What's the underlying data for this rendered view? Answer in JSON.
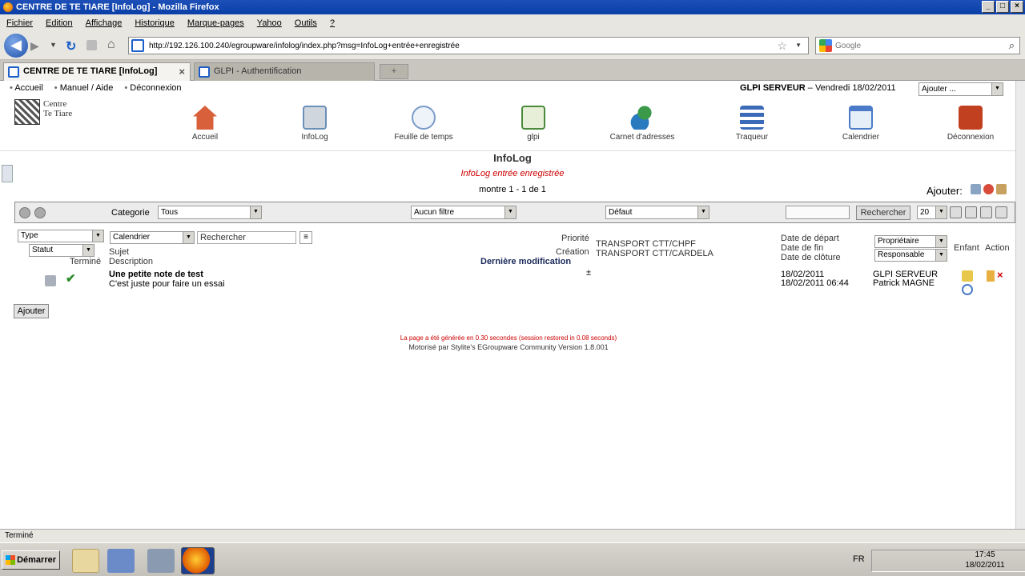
{
  "window": {
    "title": "CENTRE DE TE TIARE [InfoLog] - Mozilla Firefox",
    "buttons": [
      "_",
      "□",
      "×"
    ]
  },
  "menu": [
    "Fichier",
    "Edition",
    "Affichage",
    "Historique",
    "Marque-pages",
    "Yahoo",
    "Outils",
    "?"
  ],
  "nav": {
    "url": "http://192.126.100.240/egroupware/infolog/index.php?msg=InfoLog+entrée+enregistrée",
    "search_placeholder": "Google"
  },
  "tabs": [
    {
      "label": "CENTRE DE TE TIARE [InfoLog]",
      "active": true
    },
    {
      "label": "GLPI - Authentification",
      "active": false
    }
  ],
  "topnav": [
    "Accueil",
    "Manuel / Aide",
    "Déconnexion"
  ],
  "server": {
    "name": "GLPI SERVEUR",
    "date": " – Vendredi 18/02/2011",
    "add_select": "Ajouter ..."
  },
  "logo": {
    "line1": "Centre",
    "line2": "Te Tiare"
  },
  "apps": [
    {
      "label": "Accueil",
      "icon": "home-icon",
      "color": "#d8603a"
    },
    {
      "label": "InfoLog",
      "icon": "infolog-icon",
      "color": "#6a8fb8"
    },
    {
      "label": "Feuille de temps",
      "icon": "timesheet-icon",
      "color": "#7a9ac8"
    },
    {
      "label": "glpi",
      "icon": "glpi-icon",
      "color": "#4a8a3a"
    },
    {
      "label": "Carnet d'adresses",
      "icon": "addressbook-icon",
      "color": "#3a9a4a"
    },
    {
      "label": "Traqueur",
      "icon": "tracker-icon",
      "color": "#3a6ab8"
    },
    {
      "label": "Calendrier",
      "icon": "calendar-icon",
      "color": "#4a7ac8"
    },
    {
      "label": "Déconnexion",
      "icon": "logout-icon",
      "color": "#c04020"
    }
  ],
  "page": {
    "title": "InfoLog",
    "message": "InfoLog entrée enregistrée",
    "count": "montre 1 - 1 de 1",
    "add_label": "Ajouter:"
  },
  "filter": {
    "category_label": "Categorie",
    "category_value": "Tous",
    "filter_value": "Aucun filtre",
    "default_value": "Défaut",
    "search_button": "Rechercher",
    "page_size": "20"
  },
  "header": {
    "type": "Type",
    "status": "Statut",
    "done": "Terminé",
    "calendar": "Calendrier",
    "search_placeholder": "Rechercher",
    "subject": "Sujet",
    "description": "Description",
    "priority": "Priorité",
    "creation": "Création",
    "last_modified": "Dernière modification",
    "start_date": "Date de départ",
    "end_date": "Date de fin",
    "close_date": "Date de clôture",
    "owner": "Propriétaire",
    "responsible": "Responsable",
    "child": "Enfant",
    "action": "Action",
    "transport1": "TRANSPORT CTT/CHPF",
    "transport2": "TRANSPORT CTT/CARDELA"
  },
  "row": {
    "title": "Une petite note de test",
    "description": "C'est juste pour faire un essai",
    "priority_mark": "±",
    "start": "18/02/2011",
    "modified": "18/02/2011 06:44",
    "owner": "GLPI SERVEUR",
    "responsible": "Patrick MAGNE"
  },
  "add_button": "Ajouter",
  "footer": {
    "line1": "La page a été générée en 0.30 secondes (session restored in 0.08 seconds)",
    "line2": "Motorisé par Stylite's EGroupware Community Version 1.8.001"
  },
  "statusbar": "Terminé",
  "taskbar": {
    "start": "Démarrer",
    "lang": "FR",
    "time": "17:45",
    "date": "18/02/2011"
  }
}
